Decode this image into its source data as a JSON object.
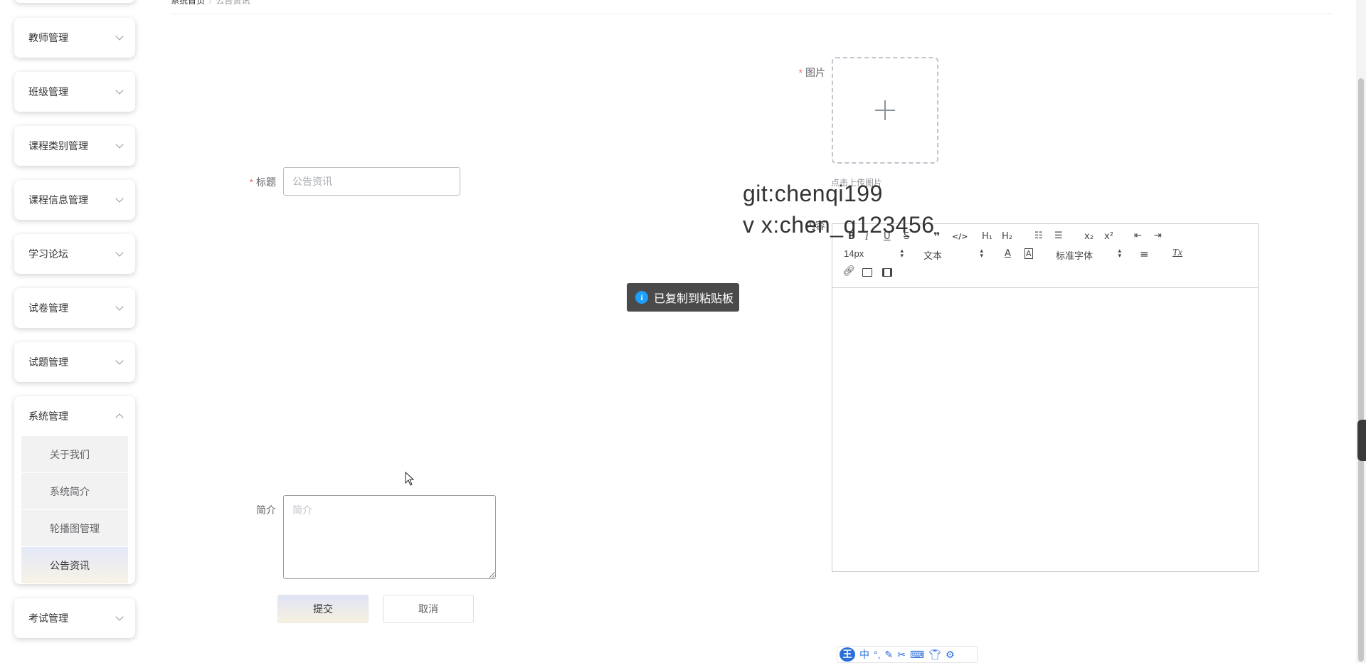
{
  "breadcrumb": {
    "home": "系统首页",
    "separator": "/",
    "current": "公告资讯"
  },
  "sidebar": {
    "menus": [
      {
        "label": "教师管理",
        "expanded": false
      },
      {
        "label": "班级管理",
        "expanded": false
      },
      {
        "label": "课程类别管理",
        "expanded": false
      },
      {
        "label": "课程信息管理",
        "expanded": false
      },
      {
        "label": "学习论坛",
        "expanded": false
      },
      {
        "label": "试卷管理",
        "expanded": false
      },
      {
        "label": "试题管理",
        "expanded": false
      },
      {
        "label": "系统管理",
        "expanded": true
      },
      {
        "label": "考试管理",
        "expanded": false
      }
    ],
    "system_submenu": [
      {
        "label": "关于我们",
        "active": false
      },
      {
        "label": "系统简介",
        "active": false
      },
      {
        "label": "轮播图管理",
        "active": false
      },
      {
        "label": "公告资讯",
        "active": true
      }
    ]
  },
  "form": {
    "title_label": "标题",
    "title_placeholder": "公告资讯",
    "image_label": "图片",
    "upload_hint": "点击上传图片",
    "content_label": "内容",
    "intro_label": "简介",
    "intro_placeholder": "简介",
    "required_mark": "*"
  },
  "editor": {
    "toolbar": {
      "bold": "B",
      "italic": "I",
      "underline": "U",
      "strike": "S",
      "quote": "❞",
      "code": "</>",
      "h1": "H₁",
      "h2": "H₂",
      "ordered_list": "☷",
      "bullet_list": "☰",
      "subscript": "x₂",
      "superscript": "x²",
      "outdent": "⇤",
      "indent": "⇥",
      "size_value": "14px",
      "header_value": "文本",
      "color": "A",
      "background": "A",
      "font_value": "标准字体",
      "align": "≡",
      "clean": "Tx"
    }
  },
  "toast": {
    "text": "已复制到粘贴板",
    "icon": "info-icon"
  },
  "watermark": {
    "line1": "git:chenqi199",
    "line2": "v x:chen_q123456"
  },
  "buttons": {
    "submit": "提交",
    "cancel": "取消"
  },
  "ime": {
    "logo": "王",
    "mode": "中",
    "punct": "°,"
  },
  "colors": {
    "accent_gradient_top": "#dfe3f6",
    "accent_gradient_bottom": "#f8f1e0",
    "required": "#f56c6c",
    "toast_bg": "#4a4a4a",
    "toast_icon": "#1e9fff"
  }
}
